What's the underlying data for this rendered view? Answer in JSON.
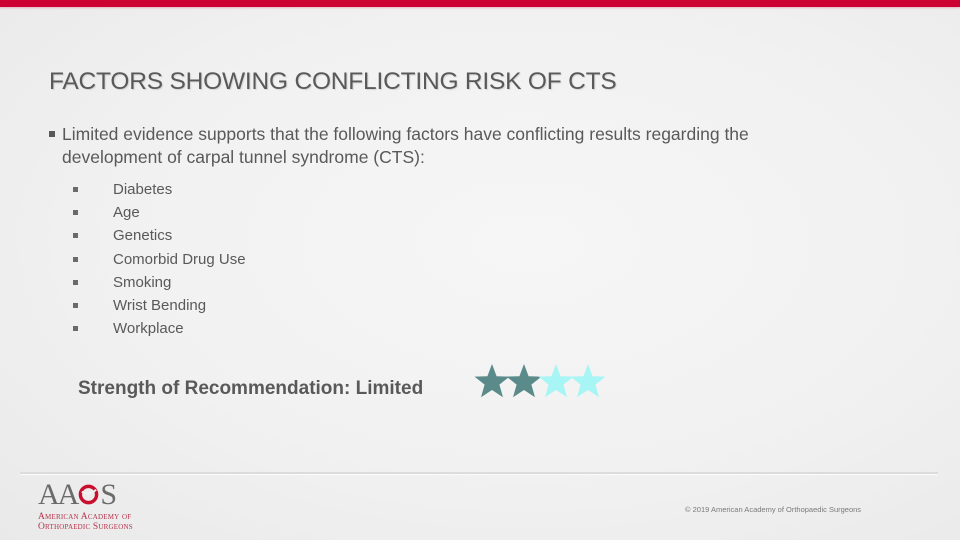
{
  "theme": {
    "accent_bar": "#cc0033",
    "text": "#595959",
    "star_filled": "#5a8a8a",
    "star_empty": "#a8f5f5",
    "logo_red": "#b5324a"
  },
  "slide": {
    "title": "FACTORS SHOWING CONFLICTING RISK OF CTS",
    "main_bullet": "Limited evidence supports that the following factors have conflicting results regarding the development of carpal tunnel syndrome (CTS):",
    "factors": [
      {
        "label": "Diabetes"
      },
      {
        "label": "Age"
      },
      {
        "label": "Genetics"
      },
      {
        "label": "Comorbid Drug Use"
      },
      {
        "label": "Smoking"
      },
      {
        "label": "Wrist Bending"
      },
      {
        "label": "Workplace"
      }
    ],
    "recommendation": {
      "label": "Strength of Recommendation: Limited",
      "rating": 2,
      "rating_max": 4
    }
  },
  "footer": {
    "logo": {
      "wordmark_left": "AA",
      "wordmark_right": "S",
      "line1": "American Academy of",
      "line2": "Orthopaedic Surgeons"
    },
    "copyright": "© 2019 American Academy of Orthopaedic Surgeons"
  }
}
